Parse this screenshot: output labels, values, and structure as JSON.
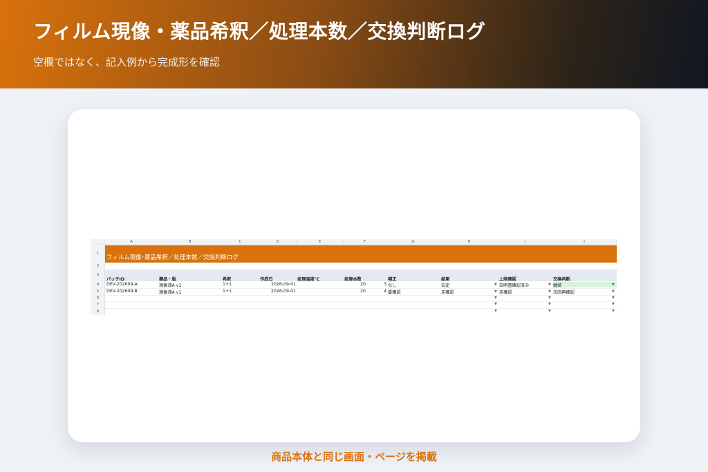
{
  "hero": {
    "title": "フィルム現像・薬品希釈／処理本数／交換判断ログ",
    "subtitle": "空欄ではなく、記入例から完成形を確認"
  },
  "sheet": {
    "columns": [
      "A",
      "B",
      "C",
      "D",
      "E",
      "F",
      "G",
      "H",
      "I",
      "J"
    ],
    "rows": [
      "1",
      "2",
      "3",
      "4",
      "5",
      "6",
      "7",
      "8"
    ],
    "title": "フィルム現像･薬品希釈／処理本数／交換判断ログ",
    "headers": [
      "バッチID",
      "薬品・版",
      "希釈",
      "作成日",
      "処理温度℃",
      "処理本数",
      "補正",
      "結果",
      "上限確認",
      "交換判断"
    ],
    "data": [
      [
        "DEV-202609-A",
        "現像液A v1",
        "1+1",
        "2026-09-01",
        "",
        "20",
        "3",
        "なし",
        "安定",
        "説明書確認済み",
        "継続"
      ],
      [
        "DEV-202609-B",
        "現像液A v1",
        "1+1",
        "2026-09-01",
        "",
        "20",
        "4",
        "要確認",
        "未確認",
        "未確認",
        "次回再確認"
      ]
    ],
    "dropdown_glyph": "▼",
    "highlight_color": "#d7f2de",
    "title_color": "#d9720c"
  },
  "caption": "商品本体と同じ画面・ページを掲載"
}
